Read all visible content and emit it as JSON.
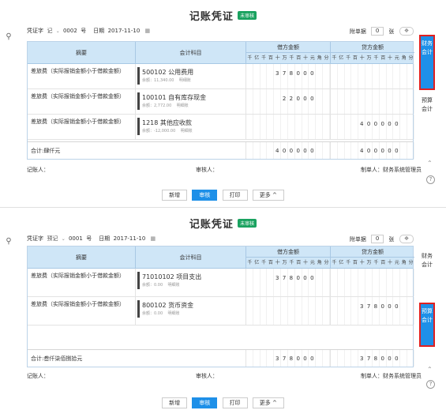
{
  "panels": [
    {
      "title": "记账凭证",
      "status": "未审核",
      "voucher_word_label": "凭证字",
      "voucher_word": "记",
      "number": "0002",
      "number_unit": "号",
      "date_label": "日期",
      "date": "2017-11-10",
      "attach_label": "附单据",
      "attach_count": "0",
      "attach_unit": "张",
      "header": {
        "summary": "摘要",
        "account": "会计科目",
        "debit": "借方金额",
        "credit": "贷方金额",
        "digits": [
          "千",
          "亿",
          "千",
          "百",
          "十",
          "万",
          "千",
          "百",
          "十",
          "元",
          "角",
          "分"
        ]
      },
      "rows": [
        {
          "summary": "差旅费（实际报销金额小于借款金额）",
          "account": "500102  公用费用",
          "balance": "余额：11,340.00",
          "detail": "明细账",
          "debit": [
            "",
            "",
            "",
            "",
            "3",
            "7",
            "8",
            "0",
            "0",
            "0"
          ],
          "credit": [
            "",
            "",
            "",
            "",
            "",
            "",
            "",
            "",
            "",
            ""
          ]
        },
        {
          "summary": "差旅费（实际报销金额小于借款金额）",
          "account": "100101  自有库存现金",
          "balance": "余额：2,772.00",
          "detail": "明细账",
          "debit": [
            "",
            "",
            "",
            "",
            "",
            "2",
            "2",
            "0",
            "0",
            "0"
          ],
          "credit": [
            "",
            "",
            "",
            "",
            "",
            "",
            "",
            "",
            "",
            ""
          ]
        },
        {
          "summary": "差旅费（实际报销金额小于借款金额）",
          "account": "1218  其他应收款",
          "balance": "余额：-12,000.00",
          "detail": "明细账",
          "debit": [
            "",
            "",
            "",
            "",
            "",
            "",
            "",
            "",
            "",
            ""
          ],
          "credit": [
            "",
            "",
            "",
            "",
            "4",
            "0",
            "0",
            "0",
            "0",
            "0"
          ]
        }
      ],
      "total_label": "合计:肆仟元",
      "total_debit": [
        "",
        "",
        "",
        "",
        "4",
        "0",
        "0",
        "0",
        "0",
        "0"
      ],
      "total_credit": [
        "",
        "",
        "",
        "",
        "4",
        "0",
        "0",
        "0",
        "0",
        "0"
      ],
      "bookkeeper_label": "记账人：",
      "reviewer_label": "审核人：",
      "maker_label": "制单人：财务系统管理员",
      "buttons": {
        "add": "新增",
        "audit": "审核",
        "print": "打印",
        "more": "更多 ^"
      },
      "sidebar": {
        "item1": "财务会计",
        "item2": "预算会计"
      }
    },
    {
      "title": "记账凭证",
      "status": "未审核",
      "voucher_word_label": "凭证字",
      "voucher_word": "预记",
      "number": "0001",
      "number_unit": "号",
      "date_label": "日期",
      "date": "2017-11-10",
      "attach_label": "附单据",
      "attach_count": "0",
      "attach_unit": "张",
      "header": {
        "summary": "摘要",
        "account": "会计科目",
        "debit": "借方金额",
        "credit": "贷方金额",
        "digits": [
          "千",
          "亿",
          "千",
          "百",
          "十",
          "万",
          "千",
          "百",
          "十",
          "元",
          "角",
          "分"
        ]
      },
      "rows": [
        {
          "summary": "差旅费（实际报销金额小于借款金额）",
          "account": "71010102  项目支出",
          "balance": "余额：0.00",
          "detail": "明细账",
          "debit": [
            "",
            "",
            "",
            "",
            "3",
            "7",
            "8",
            "0",
            "0",
            "0"
          ],
          "credit": [
            "",
            "",
            "",
            "",
            "",
            "",
            "",
            "",
            "",
            ""
          ]
        },
        {
          "summary": "差旅费（实际报销金额小于借款金额）",
          "account": "800102  货币资金",
          "balance": "余额：0.00",
          "detail": "明细账",
          "debit": [
            "",
            "",
            "",
            "",
            "",
            "",
            "",
            "",
            "",
            ""
          ],
          "credit": [
            "",
            "",
            "",
            "",
            "3",
            "7",
            "8",
            "0",
            "0",
            "0"
          ]
        }
      ],
      "total_label": "合计:叁仟柒佰捌拾元",
      "total_debit": [
        "",
        "",
        "",
        "",
        "3",
        "7",
        "8",
        "0",
        "0",
        "0"
      ],
      "total_credit": [
        "",
        "",
        "",
        "",
        "3",
        "7",
        "8",
        "0",
        "0",
        "0"
      ],
      "bookkeeper_label": "记账人：",
      "reviewer_label": "审核人：",
      "maker_label": "制单人：财务系统管理员",
      "buttons": {
        "add": "新增",
        "audit": "审核",
        "print": "打印",
        "more": "更多 ^"
      },
      "sidebar": {
        "item1": "财务会计",
        "item2": "预算会计"
      }
    }
  ],
  "icons": {
    "search": "search-icon",
    "calendar": "calendar-icon",
    "attachment": "paperclip-icon",
    "help": "help-icon",
    "chevron": "chevron-up-icon"
  },
  "colors": {
    "primary": "#1e90e8",
    "status_green": "#1aa260",
    "highlight_red": "#e02020",
    "header_blue": "#cfe6f7"
  }
}
